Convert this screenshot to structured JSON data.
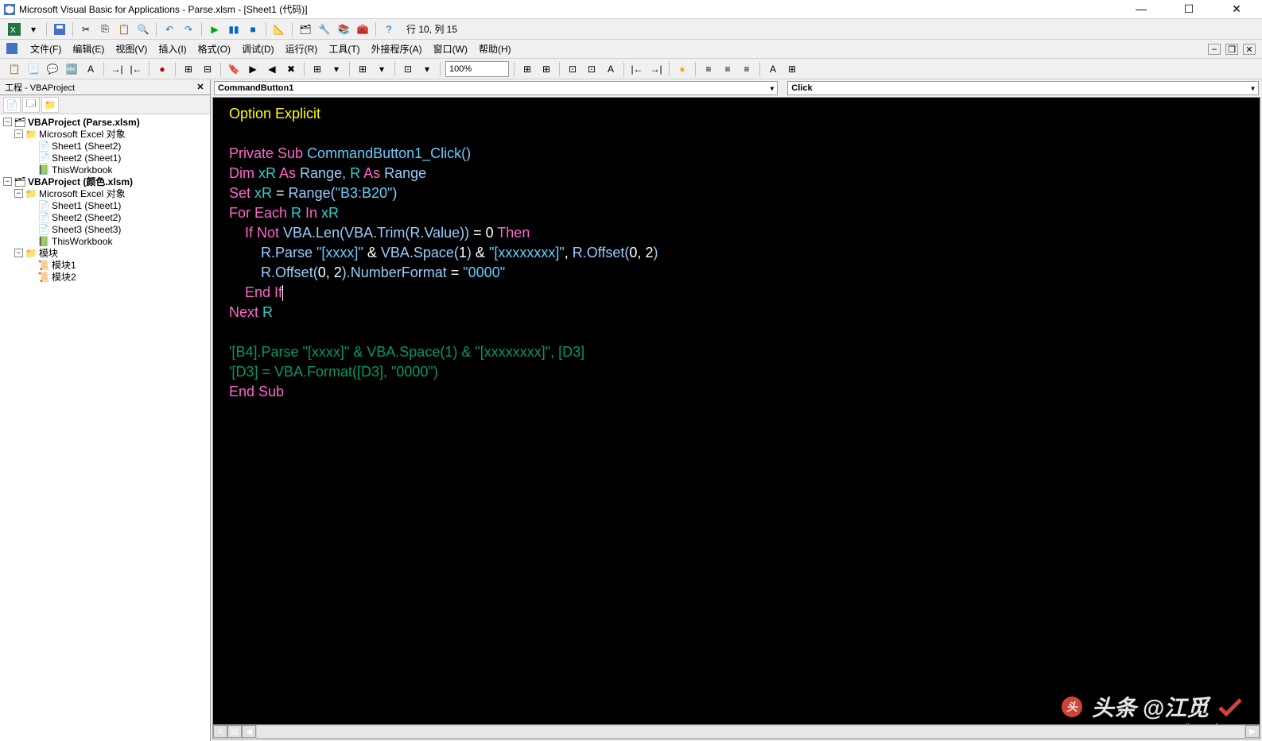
{
  "title": "Microsoft Visual Basic for Applications - Parse.xlsm - [Sheet1 (代码)]",
  "toolbar_status": "行 10, 列 15",
  "menus": {
    "file": "文件(F)",
    "edit": "编辑(E)",
    "view": "视图(V)",
    "insert": "插入(I)",
    "format": "格式(O)",
    "debug": "调试(D)",
    "run": "运行(R)",
    "tools": "工具(T)",
    "addins": "外接程序(A)",
    "window": "窗口(W)",
    "help": "帮助(H)"
  },
  "zoom": "100%",
  "project_panel_title": "工程 - VBAProject",
  "tree": {
    "proj1": "VBAProject (Parse.xlsm)",
    "proj1_folder": "Microsoft Excel 对象",
    "proj1_s1": "Sheet1 (Sheet2)",
    "proj1_s2": "Sheet2 (Sheet1)",
    "proj1_wb": "ThisWorkbook",
    "proj2": "VBAProject (颜色.xlsm)",
    "proj2_folder": "Microsoft Excel 对象",
    "proj2_s1": "Sheet1 (Sheet1)",
    "proj2_s2": "Sheet2 (Sheet2)",
    "proj2_s3": "Sheet3 (Sheet3)",
    "proj2_wb": "ThisWorkbook",
    "proj2_modfolder": "模块",
    "proj2_mod1": "模块1",
    "proj2_mod2": "模块2"
  },
  "dropdown_left": "CommandButton1",
  "dropdown_right": "Click",
  "code": {
    "l1_a": "Option Explicit",
    "l3_a": "Private Sub ",
    "l3_b": "CommandButton1_Click()",
    "l4_a": "Dim ",
    "l4_b": "xR ",
    "l4_c": "As ",
    "l4_d": "Range, ",
    "l4_e": "R ",
    "l4_f": "As ",
    "l4_g": "Range",
    "l5_a": "Set ",
    "l5_b": "xR ",
    "l5_c": "= ",
    "l5_d": "Range(",
    "l5_e": "\"B3:B20\"",
    "l5_f": ")",
    "l6_a": "For Each ",
    "l6_b": "R ",
    "l6_c": "In ",
    "l6_d": "xR",
    "l7_a": "    If Not ",
    "l7_b": "VBA.Len(VBA.Trim(R.Value)) ",
    "l7_c": "= ",
    "l7_d": "0 ",
    "l7_e": "Then",
    "l8_a": "        R.Parse ",
    "l8_b": "\"[xxxx]\" ",
    "l8_c": "& ",
    "l8_d": "VBA.Space(",
    "l8_e": "1",
    "l8_f": ") ",
    "l8_g": "& ",
    "l8_h": "\"[xxxxxxxx]\"",
    "l8_i": ", ",
    "l8_j": "R.Offset(",
    "l8_k": "0",
    "l8_l": ", ",
    "l8_m": "2",
    "l8_n": ")",
    "l9_a": "        R.Offset(",
    "l9_b": "0",
    "l9_c": ", ",
    "l9_d": "2",
    "l9_e": ").NumberFormat ",
    "l9_f": "= ",
    "l9_g": "\"0000\"",
    "l10_a": "    End If",
    "l11_a": "Next ",
    "l11_b": "R",
    "l13_a": "'[B4].Parse \"[xxxx]\" & VBA.Space(1) & \"[xxxxxxxx]\", [D3]",
    "l14_a": "'[D3] = VBA.Format([D3], \"0000\")",
    "l15_a": "End Sub"
  },
  "watermark_main": "头条 @江觅",
  "watermark_sub": "jingyanla.com"
}
